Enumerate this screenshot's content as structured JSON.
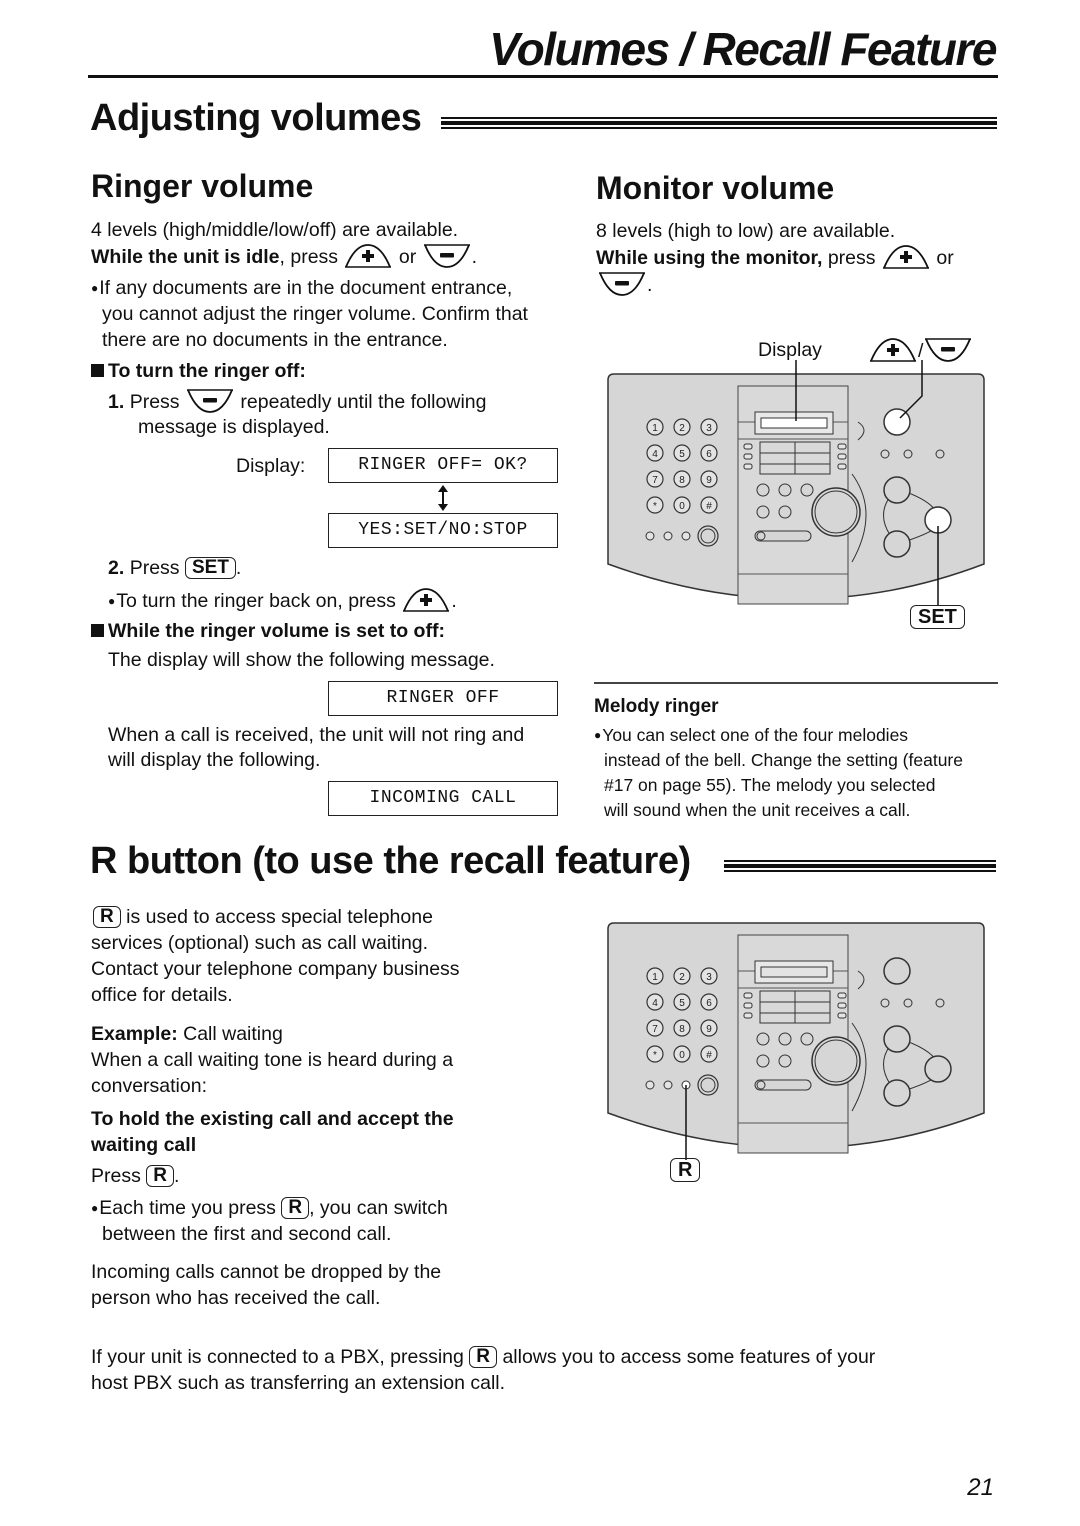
{
  "page": {
    "title": "Volumes / Recall Feature",
    "page_number": "21"
  },
  "adjusting": {
    "heading": "Adjusting volumes",
    "ringer": {
      "heading": "Ringer volume",
      "levels": "4 levels (high/middle/low/off) are available.",
      "idle_bold": "While the unit is idle",
      "idle_rest": ", press",
      "or": "or",
      "period": ".",
      "note_line1": "If any documents are in the document entrance,",
      "note_line2": "you cannot adjust the ringer volume. Confirm that",
      "note_line3": "there are no documents in the entrance.",
      "turn_off_heading": "To turn the ringer off:",
      "step1_num": "1.",
      "step1_press": "Press",
      "step1_rest": "repeatedly until the following",
      "step1_line2": "message is displayed.",
      "display_label": "Display:",
      "lcd1": "RINGER OFF= OK?",
      "lcd2": "YES:SET/NO:STOP",
      "step2_num": "2.",
      "step2_press": "Press",
      "set_key": "SET",
      "back_on": "To turn the ringer back on, press",
      "while_off_heading": "While the ringer volume is set to off:",
      "while_off_text": "The display will show the following message.",
      "lcd3": "RINGER OFF",
      "call_line1": "When a call is received, the unit will not ring and",
      "call_line2": "will display the following.",
      "lcd4": "INCOMING CALL"
    },
    "monitor": {
      "heading": "Monitor volume",
      "levels": "8 levels (high to low) are available.",
      "using_bold": "While using the monitor,",
      "using_rest": " press",
      "or": "or",
      "period": ".",
      "display_callout": "Display",
      "slash": "/",
      "set_callout": "SET",
      "melody_heading": "Melody ringer",
      "melody_line1": "You can select one of the four melodies",
      "melody_line2": "instead of the bell. Change the setting (feature",
      "melody_line3": "#17 on page 55). The melody you selected",
      "melody_line4": "will sound when the unit receives a call."
    }
  },
  "recall": {
    "heading": "R button (to use the recall feature)",
    "r_key": "R",
    "intro_line1": " is used to access special telephone",
    "intro_line2": "services (optional) such as call waiting.",
    "intro_line3": "Contact your telephone company business",
    "intro_line4": "office for details.",
    "example_bold": "Example:",
    "example_rest": " Call waiting",
    "when_line1": "When a call waiting tone is heard during a",
    "when_line2": "conversation:",
    "hold_line1": "To hold the existing call and accept the",
    "hold_line2": "waiting call",
    "press": "Press",
    "period": ".",
    "each_press": "Each time you press",
    "each_rest": ", you can switch",
    "each_line2": "between the first and second call.",
    "drop_line1": "Incoming calls cannot be dropped by the",
    "drop_line2": "person who has received the call.",
    "pbx_part1": "If your unit is connected to a PBX, pressing",
    "pbx_part2": "allows you to access some features of your",
    "pbx_line2": "host PBX such as transferring an extension call.",
    "r_callout": "R"
  },
  "keypad": [
    "1",
    "2",
    "3",
    "4",
    "5",
    "6",
    "7",
    "8",
    "9",
    "*",
    "0",
    "#"
  ]
}
